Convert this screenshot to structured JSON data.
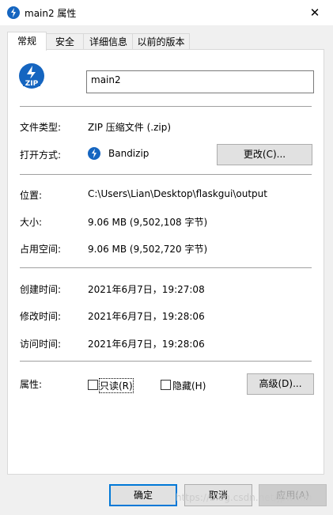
{
  "window": {
    "title": "main2 属性",
    "close_glyph": "✕"
  },
  "tabs": [
    "常规",
    "安全",
    "详细信息",
    "以前的版本"
  ],
  "file": {
    "name": "main2",
    "type_label": "文件类型:",
    "type_value": "ZIP 压缩文件 (.zip)",
    "open_label": "打开方式:",
    "open_value": "Bandizip",
    "change_button": "更改(C)...",
    "location_label": "位置:",
    "location_value": "C:\\Users\\Lian\\Desktop\\flaskgui\\output",
    "size_label": "大小:",
    "size_value": "9.06 MB (9,502,108 字节)",
    "disk_label": "占用空间:",
    "disk_value": "9.06 MB (9,502,720 字节)",
    "created_label": "创建时间:",
    "created_value": "2021年6月7日，19:27:08",
    "modified_label": "修改时间:",
    "modified_value": "2021年6月7日，19:28:06",
    "accessed_label": "访问时间:",
    "accessed_value": "2021年6月7日，19:28:06"
  },
  "attributes": {
    "label": "属性:",
    "readonly": "只读(R)",
    "hidden": "隐藏(H)",
    "advanced_button": "高级(D)..."
  },
  "footer": {
    "ok": "确定",
    "cancel": "取消",
    "apply": "应用(A)"
  },
  "watermark": "https://blog.csdn.net/jpwmm",
  "icons": {
    "file_icon": "zip-file-icon",
    "app_icon": "bandizip-icon"
  },
  "colors": {
    "accent": "#0078d7",
    "icon_blue": "#1565c0"
  }
}
